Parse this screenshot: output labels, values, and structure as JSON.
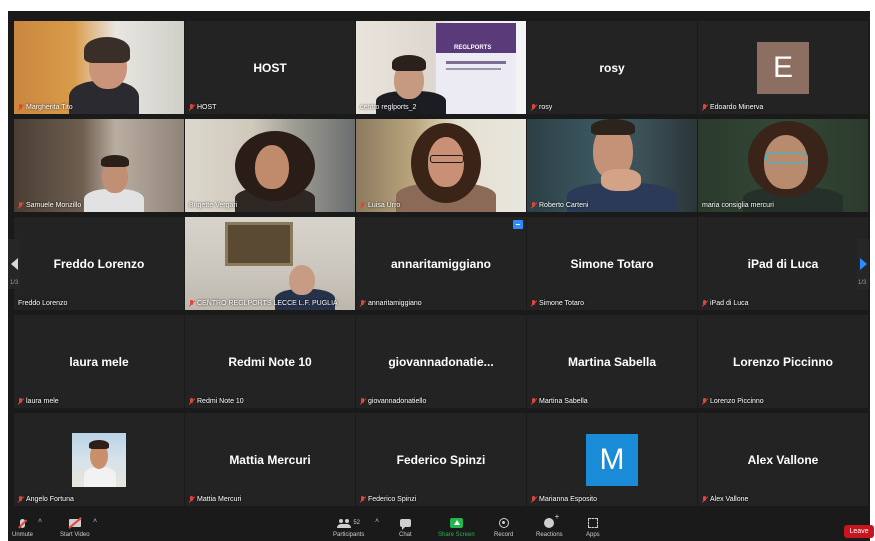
{
  "meeting": {
    "page_left": "1/3",
    "page_right": "1/3"
  },
  "tiles": [
    {
      "name": "Margherita Tito",
      "center": "",
      "video": true
    },
    {
      "name": "HOST",
      "center": "HOST",
      "video": false
    },
    {
      "name": "centro reglports_2",
      "center": "",
      "video": true
    },
    {
      "name": "rosy",
      "center": "rosy",
      "video": false
    },
    {
      "name": "Edoardo Minerva",
      "center": "",
      "avatar": "E",
      "avatar_color": "#8c6f61",
      "video": false
    },
    {
      "name": "Samuele Monzillo",
      "center": "",
      "video": true
    },
    {
      "name": "Brigette Vergari",
      "center": "",
      "video": true
    },
    {
      "name": "Luisa Urro",
      "center": "",
      "video": true
    },
    {
      "name": "Roberto Carteni",
      "center": "",
      "video": true
    },
    {
      "name": "maria consiglia mercuri",
      "center": "",
      "video": true,
      "active": true
    },
    {
      "name": "Freddo Lorenzo",
      "center": "Freddo Lorenzo",
      "video": false
    },
    {
      "name": "CENTRO REGLPORTS LECCE L.F. PUGLIA",
      "center": "",
      "video": true
    },
    {
      "name": "annaritamiggiano",
      "center": "annaritamiggiano",
      "video": false
    },
    {
      "name": "Simone Totaro",
      "center": "Simone Totaro",
      "video": false
    },
    {
      "name": "iPad di Luca",
      "center": "iPad di Luca",
      "video": false
    },
    {
      "name": "laura mele",
      "center": "laura mele",
      "video": false
    },
    {
      "name": "Redmi Note 10",
      "center": "Redmi Note 10",
      "video": false
    },
    {
      "name": "giovannadonatiello",
      "center": "giovannadonatie...",
      "video": false
    },
    {
      "name": "Martina Sabella",
      "center": "Martina Sabella",
      "video": false
    },
    {
      "name": "Lorenzo Piccinno",
      "center": "Lorenzo Piccinno",
      "video": false
    },
    {
      "name": "Angelo Fortuna",
      "center": "",
      "video": false,
      "photo": true
    },
    {
      "name": "Mattia Mercuri",
      "center": "Mattia Mercuri",
      "video": false
    },
    {
      "name": "Federico Spinzi",
      "center": "Federico Spinzi",
      "video": false
    },
    {
      "name": "Marianna Esposito",
      "center": "",
      "avatar": "M",
      "avatar_color": "#1a8bd6",
      "video": false
    },
    {
      "name": "Alex Vallone",
      "center": "Alex Vallone",
      "video": false
    }
  ],
  "poster": {
    "title": "REGLPORTS"
  },
  "toolbar": {
    "unmute": "Unmute",
    "start_video": "Start Video",
    "participants": "Participants",
    "participants_count": "52",
    "chat": "Chat",
    "share_screen": "Share Screen",
    "record": "Record",
    "reactions": "Reactions",
    "apps": "Apps",
    "leave": "Leave"
  },
  "colors": {
    "share_green": "#25b550",
    "leave_red": "#c5161d",
    "active_speaker": "#d6e27a",
    "accent_blue": "#2d8cff"
  },
  "icons": [
    "microphone-muted-icon",
    "video-off-icon",
    "participants-icon",
    "chat-icon",
    "share-screen-icon",
    "record-icon",
    "reactions-icon",
    "apps-icon",
    "chevron-left-icon",
    "chevron-right-icon"
  ]
}
